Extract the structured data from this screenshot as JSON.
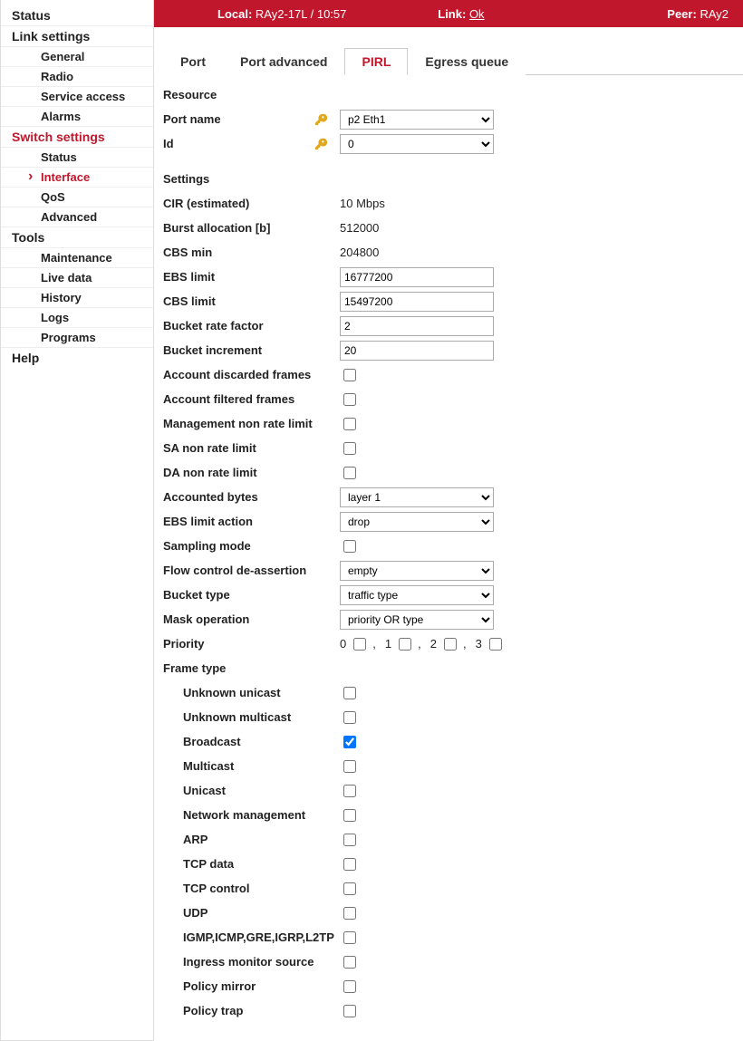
{
  "sidebar": {
    "groups": [
      {
        "label": "Status",
        "items": []
      },
      {
        "label": "Link settings",
        "items": [
          {
            "label": "General"
          },
          {
            "label": "Radio"
          },
          {
            "label": "Service access"
          },
          {
            "label": "Alarms"
          }
        ]
      },
      {
        "label": "Switch settings",
        "accent": true,
        "items": [
          {
            "label": "Status"
          },
          {
            "label": "Interface",
            "active": true
          },
          {
            "label": "QoS"
          },
          {
            "label": "Advanced"
          }
        ]
      },
      {
        "label": "Tools",
        "items": [
          {
            "label": "Maintenance"
          },
          {
            "label": "Live data"
          },
          {
            "label": "History"
          },
          {
            "label": "Logs"
          },
          {
            "label": "Programs"
          }
        ]
      },
      {
        "label": "Help",
        "items": []
      }
    ]
  },
  "topbar": {
    "local_label": "Local:",
    "local_val": "RAy2-17L / 10:57",
    "link_label": "Link:",
    "link_val": "Ok",
    "peer_label": "Peer:",
    "peer_val": "RAy2"
  },
  "tabs": [
    {
      "label": "Port"
    },
    {
      "label": "Port advanced"
    },
    {
      "label": "PIRL",
      "active": true
    },
    {
      "label": "Egress queue"
    }
  ],
  "resource": {
    "title": "Resource",
    "port_name_label": "Port name",
    "port_name_value": "p2 Eth1",
    "id_label": "Id",
    "id_value": "0"
  },
  "settings": {
    "title": "Settings",
    "cir_label": "CIR (estimated)",
    "cir_value": "10 Mbps",
    "burst_label": "Burst allocation [b]",
    "burst_value": "512000",
    "cbs_min_label": "CBS min",
    "cbs_min_value": "204800",
    "ebs_limit_label": "EBS limit",
    "ebs_limit_value": "16777200",
    "cbs_limit_label": "CBS limit",
    "cbs_limit_value": "15497200",
    "brf_label": "Bucket rate factor",
    "brf_value": "2",
    "bi_label": "Bucket increment",
    "bi_value": "20",
    "adf_label": "Account discarded frames",
    "aff_label": "Account filtered frames",
    "mnrl_label": "Management non rate limit",
    "sanrl_label": "SA non rate limit",
    "danrl_label": "DA non rate limit",
    "acc_bytes_label": "Accounted bytes",
    "acc_bytes_value": "layer 1",
    "ebs_action_label": "EBS limit action",
    "ebs_action_value": "drop",
    "sampling_label": "Sampling mode",
    "fcda_label": "Flow control de-assertion",
    "fcda_value": "empty",
    "bucket_type_label": "Bucket type",
    "bucket_type_value": "traffic type",
    "mask_op_label": "Mask operation",
    "mask_op_value": "priority OR type",
    "priority_label": "Priority",
    "priority_items": [
      "0",
      "1",
      "2",
      "3"
    ],
    "frame_type_label": "Frame type"
  },
  "frame_types": [
    {
      "label": "Unknown unicast",
      "checked": false
    },
    {
      "label": "Unknown multicast",
      "checked": false
    },
    {
      "label": "Broadcast",
      "checked": true
    },
    {
      "label": "Multicast",
      "checked": false
    },
    {
      "label": "Unicast",
      "checked": false
    },
    {
      "label": "Network management",
      "checked": false
    },
    {
      "label": "ARP",
      "checked": false
    },
    {
      "label": "TCP data",
      "checked": false
    },
    {
      "label": "TCP control",
      "checked": false
    },
    {
      "label": "UDP",
      "checked": false
    },
    {
      "label": "IGMP,ICMP,GRE,IGRP,L2TP",
      "checked": false
    },
    {
      "label": "Ingress monitor source",
      "checked": false
    },
    {
      "label": "Policy mirror",
      "checked": false
    },
    {
      "label": "Policy trap",
      "checked": false
    }
  ]
}
